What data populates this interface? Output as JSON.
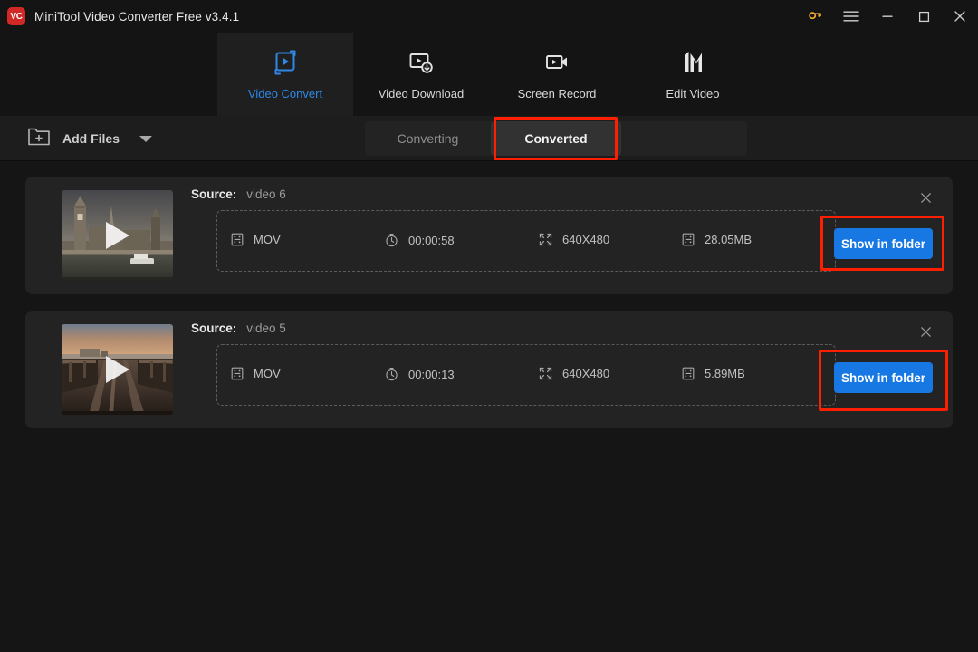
{
  "window": {
    "title": "MiniTool Video Converter Free v3.4.1",
    "logo_text": "VC",
    "logo_icon": "minitool-vc-logo",
    "controls": [
      {
        "name": "key-icon",
        "label": "Register",
        "color": "#f0ab2e"
      },
      {
        "name": "hamburger-menu-icon",
        "label": "Menu"
      },
      {
        "name": "minimize-icon",
        "label": "Minimize"
      },
      {
        "name": "maximize-icon",
        "label": "Maximize"
      },
      {
        "name": "close-icon",
        "label": "Close"
      }
    ]
  },
  "nav": {
    "active": "Video Convert",
    "accent": "#2f88e8",
    "tabs": [
      {
        "label": "Video Convert",
        "icon": "convert-loop-icon",
        "active": true
      },
      {
        "label": "Video Download",
        "icon": "video-download-icon",
        "active": false
      },
      {
        "label": "Screen Record",
        "icon": "screen-record-icon",
        "active": false
      },
      {
        "label": "Edit Video",
        "icon": "edit-video-icon",
        "active": false
      }
    ]
  },
  "toolbar": {
    "add_files_label": "Add Files",
    "add_files_icon": "folder-plus-icon",
    "dropdown_icon": "chevron-down-icon",
    "segments": [
      {
        "label": "Converting",
        "active": false
      },
      {
        "label": "Converted",
        "active": true
      }
    ]
  },
  "annotations": {
    "color": "#fe1e00",
    "targets": [
      "converted-tab",
      "show-in-folder-button-1",
      "show-in-folder-button-2"
    ]
  },
  "cards": [
    {
      "source_label": "Source:",
      "source_value": "video 6",
      "thumbnail": "houses-of-parliament-thumbnail",
      "play_icon": "play-triangle-icon",
      "close_icon": "close-icon",
      "meta": {
        "format": "MOV",
        "format_icon": "file-format-icon",
        "duration": "00:00:58",
        "duration_icon": "stopwatch-icon",
        "resolution": "640X480",
        "resolution_icon": "resize-icon",
        "size": "28.05MB",
        "size_icon": "file-size-icon"
      },
      "action_label": "Show in folder",
      "action_color": "#1778e3"
    },
    {
      "source_label": "Source:",
      "source_value": "video 5",
      "thumbnail": "wooden-pier-sunset-thumbnail",
      "play_icon": "play-triangle-icon",
      "close_icon": "close-icon",
      "meta": {
        "format": "MOV",
        "format_icon": "file-format-icon",
        "duration": "00:00:13",
        "duration_icon": "stopwatch-icon",
        "resolution": "640X480",
        "resolution_icon": "resize-icon",
        "size": "5.89MB",
        "size_icon": "file-size-icon"
      },
      "action_label": "Show in folder",
      "action_color": "#1778e3"
    }
  ]
}
